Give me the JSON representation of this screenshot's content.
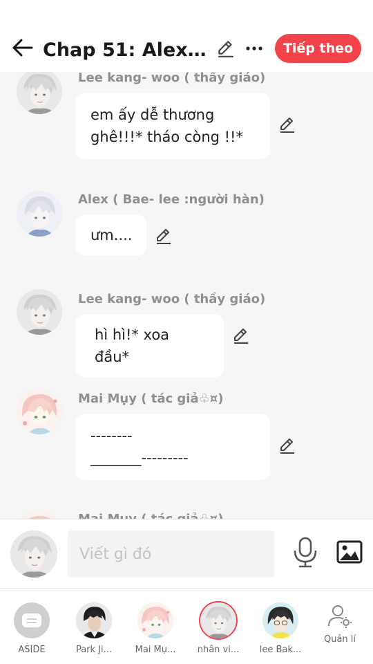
{
  "header": {
    "title": "Chap 51: Alex v...",
    "next_label": "Tiếp theo"
  },
  "messages": [
    {
      "sender": "Lee kang- woo ( thầy giáo)",
      "text_lines": [
        "em ấy dễ thương",
        "ghê!!!* tháo còng !!*"
      ],
      "avatar": "lee-kang-woo-avatar"
    },
    {
      "sender": "Alex (  Bae- lee :người hàn)",
      "text_lines": [
        "ưm...."
      ],
      "avatar": "alex-avatar"
    },
    {
      "sender": "Lee kang- woo ( thầy giáo)",
      "text_lines": [
        "hì hì!* xoa đầu*"
      ],
      "avatar": "lee-kang-woo-avatar"
    },
    {
      "sender": "Mai Mụy ( tác giả♧¤)",
      "text_lines": [
        "--------",
        "_______---------"
      ],
      "avatar": "mai-muy-avatar"
    },
    {
      "sender": "Mai Mụy ( tác giả♧¤)",
      "text_lines": [],
      "avatar": "mai-muy-avatar"
    }
  ],
  "composer": {
    "placeholder": "Viết gì đó"
  },
  "characters": [
    {
      "name": "ASIDE",
      "icon": "aside-chat-icon"
    },
    {
      "name": "Park Ji...",
      "icon": "park-ji-avatar"
    },
    {
      "name": "Mai Mụ...",
      "icon": "mai-muy-avatar"
    },
    {
      "name": "nhân vi...",
      "icon": "nhan-vien-avatar",
      "selected": true
    },
    {
      "name": "lee Bak...",
      "icon": "lee-bak-avatar"
    },
    {
      "name": "Quản lí",
      "icon": "manage-user-icon"
    }
  ],
  "colors": {
    "accent": "#f2434b",
    "background": "#f6f6f6",
    "bubble": "#ffffff",
    "sender_text": "#8f8f8f"
  }
}
